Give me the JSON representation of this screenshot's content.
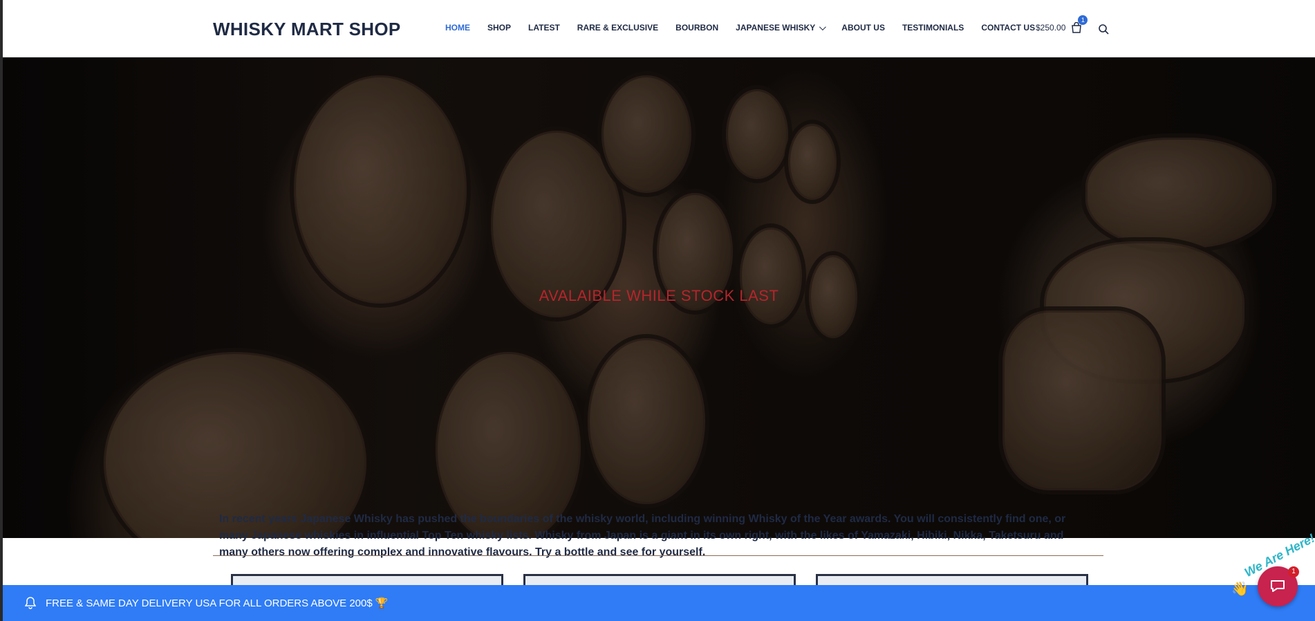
{
  "header": {
    "logo": "WHISKY MART SHOP",
    "nav": [
      {
        "label": "HOME",
        "active": true
      },
      {
        "label": "SHOP"
      },
      {
        "label": "LATEST"
      },
      {
        "label": "RARE & EXCLUSIVE"
      },
      {
        "label": "BOURBON"
      },
      {
        "label": "JAPANESE WHISKY",
        "has_dropdown": true
      },
      {
        "label": "ABOUT US"
      },
      {
        "label": "TESTIMONIALS"
      },
      {
        "label": "CONTACT US"
      }
    ],
    "cart_total": "$250.00",
    "cart_count": "1",
    "icons": {
      "cart": "cart-icon",
      "search": "search-icon",
      "dropdown": "chevron-down-icon"
    }
  },
  "hero": {
    "title": "AVALAIBLE WHILE STOCK LAST"
  },
  "intro": {
    "text": "In recent years Japanese Whisky has pushed the boundaries of the whisky world, including winning Whisky of the Year awards. You will consistently find one, or many Japanese whiskies in influential Top Ten whisky lists. Whisky from Japan is a giant in its own right, with the likes of Yamazaki, Hibiki, Nikka, Taketsuru and many others now offering complex and innovative flavours. Try a bottle and see for yourself."
  },
  "notice": {
    "text": "FREE & SAME DAY DELIVERY USA FOR ALL ORDERS ABOVE 200$ 🏆",
    "icon": "bell-icon"
  },
  "chat": {
    "label": "We Are Here!",
    "unread": "1",
    "icon": "chat-icon"
  },
  "colors": {
    "accent": "#2f6bd6",
    "notice_bg": "#2f7cf6",
    "hero_title": "#b5252c",
    "chat": "#c8224e"
  }
}
